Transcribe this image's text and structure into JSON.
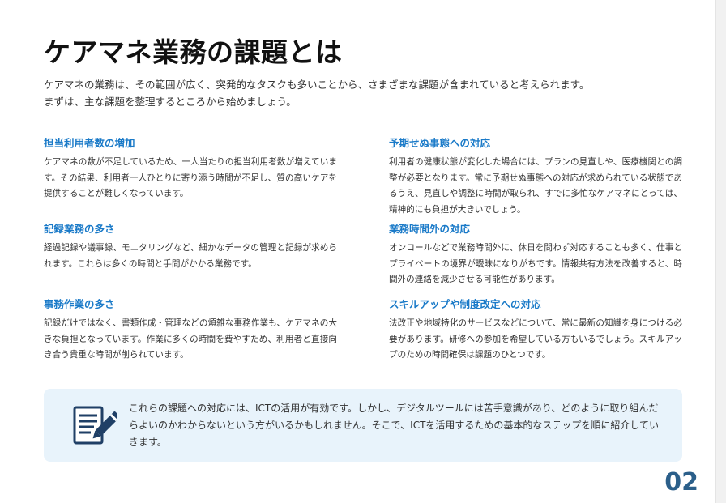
{
  "title": "ケアマネ業務の課題とは",
  "intro": {
    "line1": "ケアマネの業務は、その範囲が広く、突発的なタスクも多いことから、さまざまな課題が含まれていると考えられます。",
    "line2": "まずは、主な課題を整理するところから始めましょう。"
  },
  "items": [
    {
      "title": "担当利用者数の増加",
      "body": "ケアマネの数が不足しているため、一人当たりの担当利用者数が増えています。その結果、利用者一人ひとりに寄り添う時間が不足し、質の高いケアを提供することが難しくなっています。"
    },
    {
      "title": "記録業務の多さ",
      "body": "経過記録や議事録、モニタリングなど、細かなデータの管理と記録が求められます。これらは多くの時間と手間がかかる業務です。"
    },
    {
      "title": "事務作業の多さ",
      "body": "記録だけではなく、書類作成・管理などの煩雑な事務作業も、ケアマネの大きな負担となっています。作業に多くの時間を費やすため、利用者と直接向き合う貴重な時間が削られています。"
    },
    {
      "title": "予期せぬ事態への対応",
      "body": "利用者の健康状態が変化した場合には、プランの見直しや、医療機関との調整が必要となります。常に予期せぬ事態への対応が求められている状態であるうえ、見直しや調整に時間が取られ、すでに多忙なケアマネにとっては、精神的にも負担が大きいでしょう。"
    },
    {
      "title": "業務時間外の対応",
      "body": "オンコールなどで業務時間外に、休日を問わず対応することも多く、仕事とプライベートの境界が曖昧になりがちです。情報共有方法を改善すると、時間外の連絡を減少させる可能性があります。"
    },
    {
      "title": "スキルアップや制度改定への対応",
      "body": "法改正や地域特化のサービスなどについて、常に最新の知識を身につける必要があります。研修への参加を希望している方もいるでしょう。スキルアップのための時間確保は課題のひとつです。"
    }
  ],
  "callout": {
    "icon": "document-pen-icon",
    "text": "これらの課題への対応には、ICTの活用が有効です。しかし、デジタルツールには苦手意識があり、どのように取り組んだらよいのかわからないという方がいるかもしれません。そこで、ICTを活用するための基本的なステップを順に紹介していきます。"
  },
  "page_number": "02",
  "colors": {
    "heading_blue": "#1a7ac8",
    "callout_bg": "#e8f3fb",
    "icon_navy": "#1f3f66",
    "page_number": "#2b5f8a"
  }
}
